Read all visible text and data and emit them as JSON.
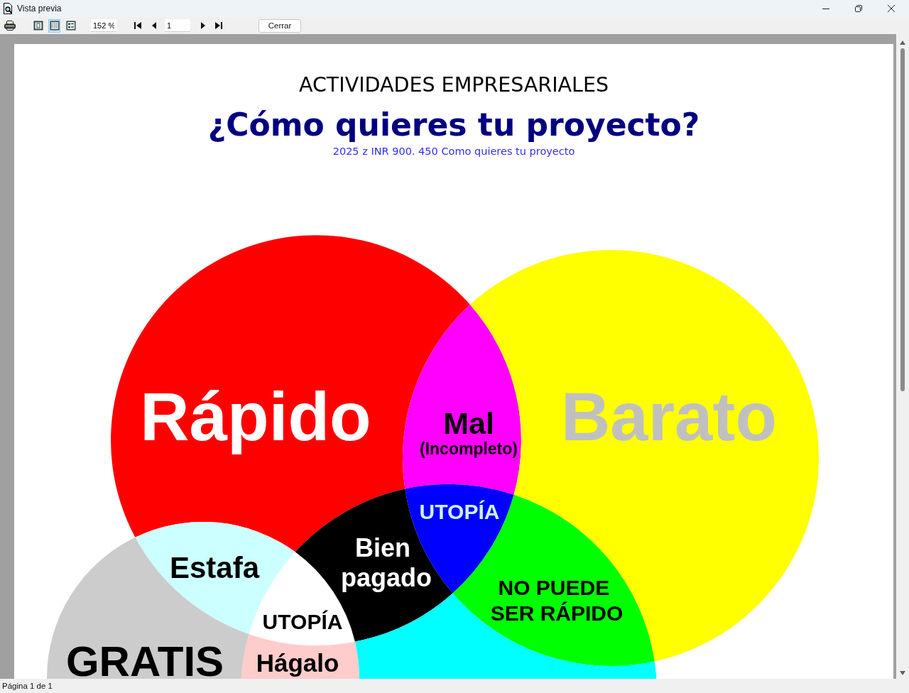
{
  "window": {
    "title": "Vista previa"
  },
  "toolbar": {
    "view_modes": [
      {
        "selected": false
      },
      {
        "selected": true
      },
      {
        "selected": false
      }
    ],
    "zoom": "152 %",
    "page": "1",
    "close_button": "Cerrar"
  },
  "document": {
    "heading": "ACTIVIDADES EMPRESARIALES",
    "title": "¿Cómo quieres tu proyecto?",
    "subtitle": "2025 z INR 900. 450 Como quieres tu proyecto",
    "venn": {
      "regions": [
        {
          "lines": [
            "Rápido"
          ],
          "color": "#ff0000"
        },
        {
          "lines": [
            "Mal"
          ],
          "note": "(Incompleto)",
          "color": "#ff00ff"
        },
        {
          "lines": [
            "Barato"
          ],
          "color": "#ffff00"
        },
        {
          "lines": [
            "UTOPÍA"
          ],
          "color": "#0000ff"
        },
        {
          "lines": [
            "Estafa"
          ],
          "color": "#ccffff"
        },
        {
          "lines": [
            "Bien",
            "pagado"
          ],
          "color": "#000000"
        },
        {
          "lines": [
            "UTOPÍA"
          ]
        },
        {
          "lines": [
            "NO PUEDE",
            "SER RÁPIDO"
          ],
          "color": "#00ff00"
        },
        {
          "lines": [
            "GRATIS"
          ],
          "color": "#cccccc"
        },
        {
          "lines": [
            "Hágalo"
          ],
          "color": "#ffcccc"
        },
        {
          "color": "#00ffff"
        }
      ]
    }
  },
  "status_bar": {
    "text": "Página 1 de 1"
  }
}
